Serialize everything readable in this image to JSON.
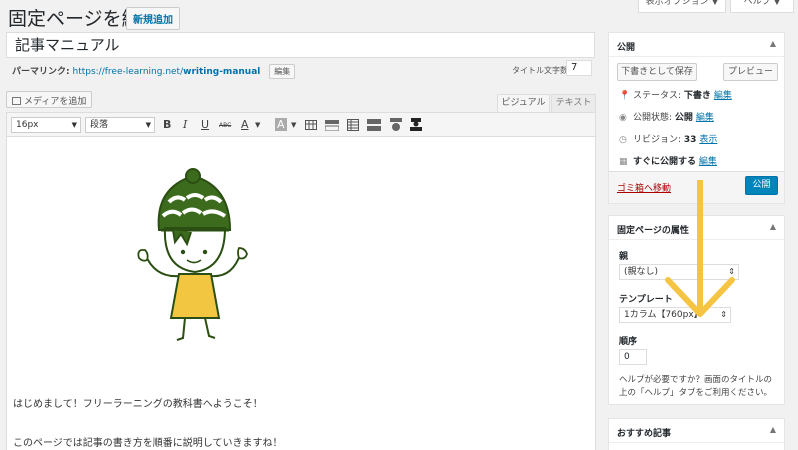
{
  "header": {
    "title": "固定ページを編集",
    "add_new": "新規追加",
    "screen_options": "表示オプション ▼",
    "help": "ヘルプ ▼"
  },
  "post": {
    "title": "記事マニュアル",
    "permalink_label": "パーマリンク:",
    "permalink_base": "https://free-learning.net/",
    "permalink_slug": "writing-manual",
    "permalink_edit": "編集",
    "title_count_label": "タイトル文字数:",
    "title_count": "7"
  },
  "editor": {
    "add_media": "メディアを追加",
    "tab_visual": "ビジュアル",
    "tab_text": "テキスト",
    "font_size": "16px",
    "format": "段落",
    "tools": [
      "B",
      "I",
      "U",
      "ABC",
      "A",
      "A"
    ],
    "paragraphs": [
      "はじめまして！フリーラーニングの教科書へようこそ！",
      "このページでは記事の書き方を順番に説明していきますね！"
    ]
  },
  "publish_box": {
    "title": "公開",
    "save_draft": "下書きとして保存",
    "preview": "プレビュー",
    "status_label": "ステータス:",
    "status_value": "下書き",
    "visibility_label": "公開状態:",
    "visibility_value": "公開",
    "revisions_label": "リビジョン:",
    "revisions_value": "33",
    "revisions_link": "表示",
    "schedule_label": "すぐに公開する",
    "edit": "編集",
    "trash": "ゴミ箱へ移動",
    "publish": "公開"
  },
  "attributes_box": {
    "title": "固定ページの属性",
    "parent_label": "親",
    "parent_value": "(親なし)",
    "template_label": "テンプレート",
    "template_value": "1カラム【760px】",
    "order_label": "順序",
    "order_value": "0",
    "help_text": "ヘルプが必要ですか？画面のタイトルの上の「ヘルプ」タブをご利用ください。"
  },
  "recommended_box": {
    "title": "おすすめ記事"
  },
  "colors": {
    "accent": "#0085ba",
    "link": "#0073aa",
    "arrow": "#f5c443",
    "character_green": "#3c6b1e",
    "character_yellow": "#f2c640"
  }
}
